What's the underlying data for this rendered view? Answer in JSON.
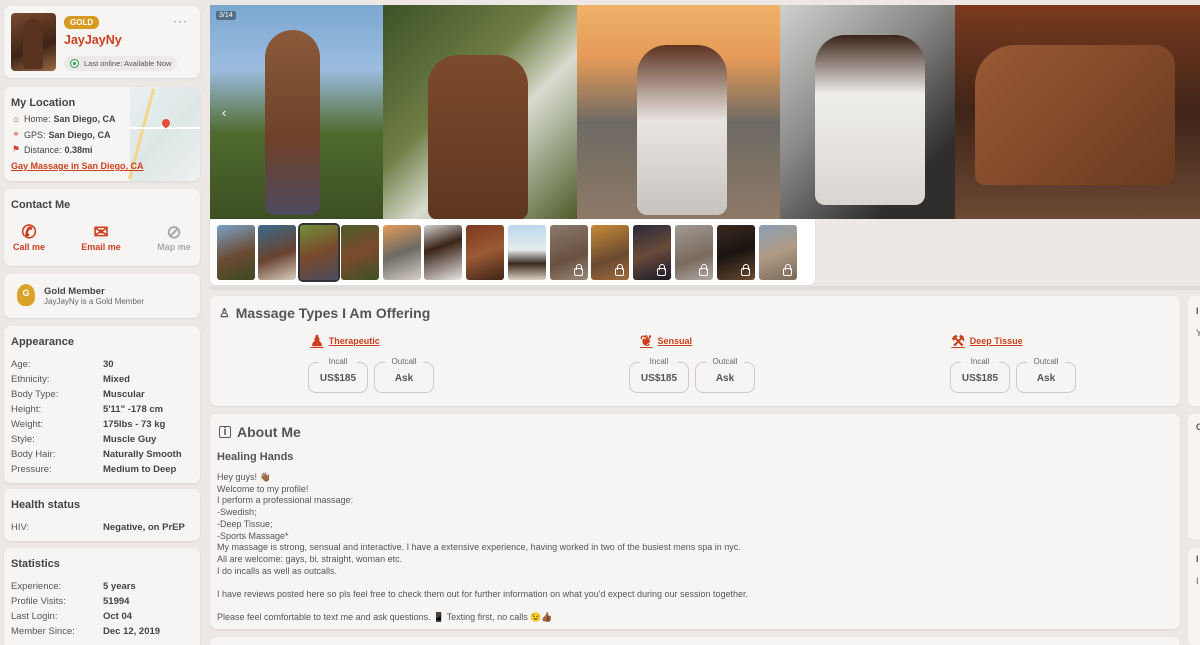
{
  "profile": {
    "badge": "GOLD",
    "name": "JayJayNy",
    "status": "Last online: Available Now",
    "menu": "···"
  },
  "location": {
    "title": "My Location",
    "home_label": "Home:",
    "home_value": "San Diego, CA",
    "gps_label": "GPS:",
    "gps_value": "San Diego, CA",
    "distance_label": "Distance:",
    "distance_value": "0.38mi",
    "link": "Gay Massage in San Diego, CA"
  },
  "contact": {
    "title": "Contact Me",
    "call": "Call me",
    "email": "Email me",
    "map": "Map me"
  },
  "gold_member": {
    "badge_letter": "G",
    "title": "Gold Member",
    "subtitle": "JayJayNy is a Gold Member"
  },
  "appearance": {
    "title": "Appearance",
    "rows": [
      {
        "k": "Age:",
        "v": "30"
      },
      {
        "k": "Ethnicity:",
        "v": "Mixed"
      },
      {
        "k": "Body Type:",
        "v": "Muscular"
      },
      {
        "k": "Height:",
        "v": "5'11\" -178 cm"
      },
      {
        "k": "Weight:",
        "v": "175lbs - 73 kg"
      },
      {
        "k": "Style:",
        "v": "Muscle Guy"
      },
      {
        "k": "Body Hair:",
        "v": "Naturally Smooth"
      },
      {
        "k": "Pressure:",
        "v": "Medium to Deep"
      }
    ]
  },
  "health": {
    "title": "Health status",
    "rows": [
      {
        "k": "HIV:",
        "v": "Negative, on PrEP"
      }
    ]
  },
  "statistics": {
    "title": "Statistics",
    "rows": [
      {
        "k": "Experience:",
        "v": "5 years"
      },
      {
        "k": "Profile Visits:",
        "v": "51994"
      },
      {
        "k": "Last Login:",
        "v": "Oct 04"
      },
      {
        "k": "Member Since:",
        "v": "Dec 12, 2019"
      }
    ]
  },
  "gallery": {
    "counter": "3/14",
    "prev": "‹",
    "thumbnail_count": 14,
    "selected_thumbnail": 3,
    "locked_from": 10
  },
  "massage": {
    "title": "Massage Types I Am Offering",
    "types": [
      {
        "name": "Therapeutic",
        "icon": "therapist-icon",
        "incall_label": "Incall",
        "incall": "US$185",
        "outcall_label": "Outcall",
        "outcall": "Ask"
      },
      {
        "name": "Sensual",
        "icon": "lotus-icon",
        "incall_label": "Incall",
        "incall": "US$185",
        "outcall_label": "Outcall",
        "outcall": "Ask"
      },
      {
        "name": "Deep Tissue",
        "icon": "massage-roller-icon",
        "incall_label": "Incall",
        "incall": "US$185",
        "outcall_label": "Outcall",
        "outcall": "Ask"
      }
    ]
  },
  "about": {
    "title": "About Me",
    "headline": "Healing Hands",
    "lines": [
      "Hey guys! 👋🏾",
      "Welcome to my profile!",
      "I perform a professional massage:",
      "-Swedish;",
      "-Deep Tissue;",
      "-Sports Massage*",
      "My massage is strong, sensual and interactive. I have a extensive experience, having worked in two of the busiest mens spa in nyc.",
      "All are welcome: gays, bi, straight, woman etc.",
      "I do incalls as well as outcalls.",
      "",
      "I have reviews posted here so pls feel free to check them out for further information on what you'd expect during our session together.",
      "",
      "Please feel comfortable to text me and ask questions. 📱 Texting first, no calls 😉👍🏾"
    ]
  },
  "right_sidebar": {
    "fragments": [
      "I",
      "Y",
      "C",
      "I",
      "I"
    ]
  },
  "colors": {
    "accent": "#cc3f1c",
    "gold": "#d79a22",
    "online": "#2aa44f",
    "background": "#ede8e6",
    "card": "#f7f5f4"
  }
}
